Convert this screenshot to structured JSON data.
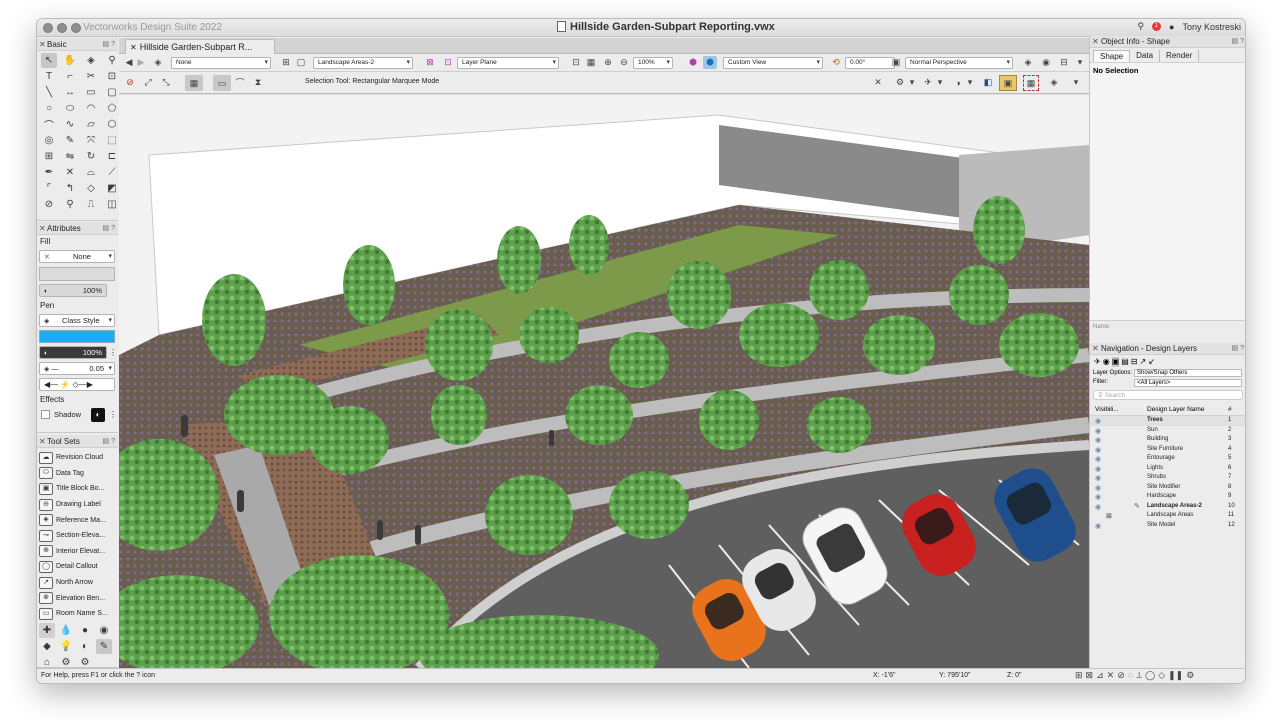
{
  "app": {
    "title": "Vectorworks Design Suite 2022",
    "document_title": "Hillside Garden-Subpart Reporting.vwx",
    "user": "Tony Kostreski",
    "notification_count": "1"
  },
  "basic_palette": {
    "title": "Basic",
    "tools": [
      "selection-tool",
      "pan-tool",
      "flyover-tool",
      "zoom-tool",
      "text-tool",
      "callout-tool",
      "trim-tool",
      "attribute-mapping-tool",
      "line-tool",
      "dimension-tool",
      "rectangle-tool",
      "rounded-rectangle-tool",
      "circle-tool",
      "oval-tool",
      "arc-tool",
      "polygon-tool",
      "double-line-tool",
      "freehand-tool",
      "pipette-tool",
      "hexagon-tool",
      "spiral-tool",
      "eyedropper-tool",
      "move-tool",
      "reshape-tool",
      "offset-tool",
      "mirror-tool",
      "rotate-tool",
      "split-tool",
      "bezier-tool",
      "scissors-tool",
      "fillet-tool",
      "chamfer-tool",
      "connect-tool",
      "clip-tool",
      "polyline-tool",
      "shape-tool",
      "wall-tool",
      "measure-tool",
      "dimension-line-tool",
      "loci-tool"
    ]
  },
  "attributes": {
    "title": "Attributes",
    "fill_label": "Fill",
    "fill_value": "None",
    "fill_opacity": "100%",
    "pen_label": "Pen",
    "pen_value": "Class Style",
    "pen_color": "#18aef0",
    "pen_opacity": "100%",
    "line_weight": "0.05",
    "effects_label": "Effects",
    "shadow_label": "Shadow"
  },
  "tool_sets": {
    "title": "Tool Sets",
    "items": [
      "Revision Cloud",
      "Data Tag",
      "Title Block Bo...",
      "Drawing Label",
      "Reference Ma...",
      "Section-Eleva...",
      "Interior Elevat...",
      "Detail Callout",
      "North Arrow",
      "Elevation Ben...",
      "Room Name S..."
    ]
  },
  "document_tab": {
    "label": "Hillside Garden-Subpart R..."
  },
  "view_bar": {
    "class_value": "None",
    "layer_value": "Landscape Areas-2",
    "plane_value": "Layer Plane",
    "zoom": "100%",
    "view_value": "Custom View",
    "rotation": "0.00°",
    "projection": "Normal Perspective"
  },
  "mode_bar": {
    "help_text": "Selection Tool: Rectangular Marquee Mode"
  },
  "object_info": {
    "title": "Object Info - Shape",
    "tabs": [
      "Shape",
      "Data",
      "Render"
    ],
    "active_tab": "Shape",
    "selection_text": "No Selection",
    "name_label": "Name:"
  },
  "navigation": {
    "title": "Navigation - Design Layers",
    "layer_options_label": "Layer Options:",
    "layer_options_value": "Show/Snap Others",
    "filter_label": "Filter:",
    "filter_value": "<All Layers>",
    "search_placeholder": "Search",
    "col_visibility": "Visibili...",
    "col_name": "Design Layer Name",
    "col_number": "#",
    "layers": [
      {
        "name": "Trees",
        "num": "1"
      },
      {
        "name": "Sun",
        "num": "2"
      },
      {
        "name": "Building",
        "num": "3"
      },
      {
        "name": "Site Furniture",
        "num": "4"
      },
      {
        "name": "Entourage",
        "num": "5"
      },
      {
        "name": "Lights",
        "num": "6"
      },
      {
        "name": "Shrubs",
        "num": "7"
      },
      {
        "name": "Site Modifier",
        "num": "8"
      },
      {
        "name": "Hardscape",
        "num": "9"
      },
      {
        "name": "Landscape Areas-2",
        "num": "10"
      },
      {
        "name": "Landscape Areas",
        "num": "11"
      },
      {
        "name": "Site Model",
        "num": "12"
      }
    ]
  },
  "status_bar": {
    "help": "For Help, press F1 or click the ? icon",
    "x": "X: -1'6\"",
    "y": "Y: 795'10\"",
    "z": "Z: 0\""
  },
  "colors": {
    "accent": "#18aef0",
    "tree": "#5aa04a",
    "paving": "#8a6a55",
    "path": "#bdbdbd",
    "car_orange": "#e9731c",
    "car_red": "#c92020",
    "car_blue": "#1e4e8c"
  }
}
